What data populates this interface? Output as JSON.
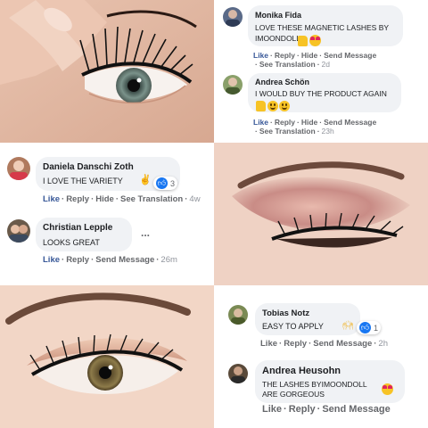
{
  "comments": [
    {
      "name": "Monika Fida",
      "text": "LOVE THESE MAGNETIC LASHES BY IMOONDOLL!!",
      "actions": {
        "like": "Like",
        "reply": "Reply",
        "hide": "Hide",
        "send": "Send Message",
        "see": "See Translation",
        "time": "2d"
      },
      "emojis": [
        "thumbs-up",
        "heart-eyes"
      ]
    },
    {
      "name": "Andrea Schön",
      "text": "I WOULD BUY THE PRODUCT AGAIN",
      "emojis": [
        "thumbs-up",
        "grinning",
        "grinning"
      ],
      "actions": {
        "like": "Like",
        "reply": "Reply",
        "hide": "Hide",
        "send": "Send Message",
        "see": "See Translation",
        "time": "23h"
      }
    },
    {
      "name": "Daniela Danschi Zoth",
      "text": "I LOVE THE VARIETY",
      "emoji": "ok-hand",
      "reaction_count": "3",
      "actions": {
        "like": "Like",
        "reply": "Reply",
        "hide": "Hide",
        "see": "See Translation",
        "time": "4w"
      }
    },
    {
      "name": "Christian Lepple",
      "text": "LOOKS GREAT",
      "more": "...",
      "actions": {
        "like": "Like",
        "reply": "Reply",
        "send": "Send Message",
        "time": "26m"
      }
    },
    {
      "name": "Tobias Notz",
      "text": "EASY TO APPLY",
      "emoji": "raising-hands",
      "reaction_count": "1",
      "actions": {
        "like": "Like",
        "reply": "Reply",
        "send": "Send Message",
        "time": "2h"
      }
    },
    {
      "name": "Andrea Heusohn",
      "text": "THE LASHES BYIMOONDOLL ARE GORGEOUS",
      "emoji": "heart-eyes",
      "actions": {
        "like": "Like",
        "reply": "Reply",
        "send": "Send Message"
      }
    }
  ],
  "colors": {
    "link": "#385898",
    "bubble": "#f0f2f5",
    "meta": "#65676b",
    "like_blue": "#1877f2",
    "love_red": "#f33e58"
  }
}
